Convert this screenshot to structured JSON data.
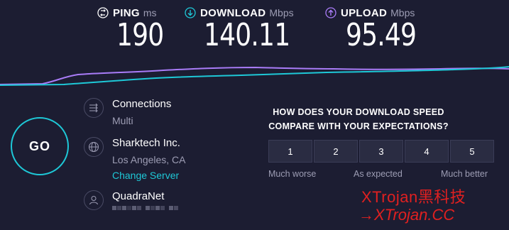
{
  "metrics": {
    "ping": {
      "label": "PING",
      "unit": "ms",
      "value": "190",
      "color": "#ffffff"
    },
    "download": {
      "label": "DOWNLOAD",
      "unit": "Mbps",
      "value": "140.11",
      "color": "#1ec8d7"
    },
    "upload": {
      "label": "UPLOAD",
      "unit": "Mbps",
      "value": "95.49",
      "color": "#a97cf8"
    }
  },
  "go_button": {
    "label": "GO"
  },
  "connection": {
    "connections_title": "Connections",
    "connections_mode": "Multi",
    "server_name": "Sharktech Inc.",
    "server_location": "Los Angeles, CA",
    "change_server": "Change Server",
    "provider": "QuadraNet"
  },
  "survey": {
    "question": "HOW DOES YOUR DOWNLOAD SPEED COMPARE WITH YOUR EXPECTATIONS?",
    "options": [
      "1",
      "2",
      "3",
      "4",
      "5"
    ],
    "low_label": "Much worse",
    "mid_label": "As expected",
    "high_label": "Much better"
  },
  "watermark": {
    "line1": "XTrojan黑科技",
    "line2": "→XTrojan.CC"
  },
  "colors": {
    "background": "#1c1d32",
    "accent": "#1ec8d7",
    "upload": "#a97cf8",
    "muted": "#9d9db4"
  },
  "icons": {
    "ping": "ping-arrows-icon",
    "download": "download-arrow-icon",
    "upload": "upload-arrow-icon",
    "connections": "connections-arrows-icon",
    "server": "globe-icon",
    "provider": "person-icon"
  }
}
